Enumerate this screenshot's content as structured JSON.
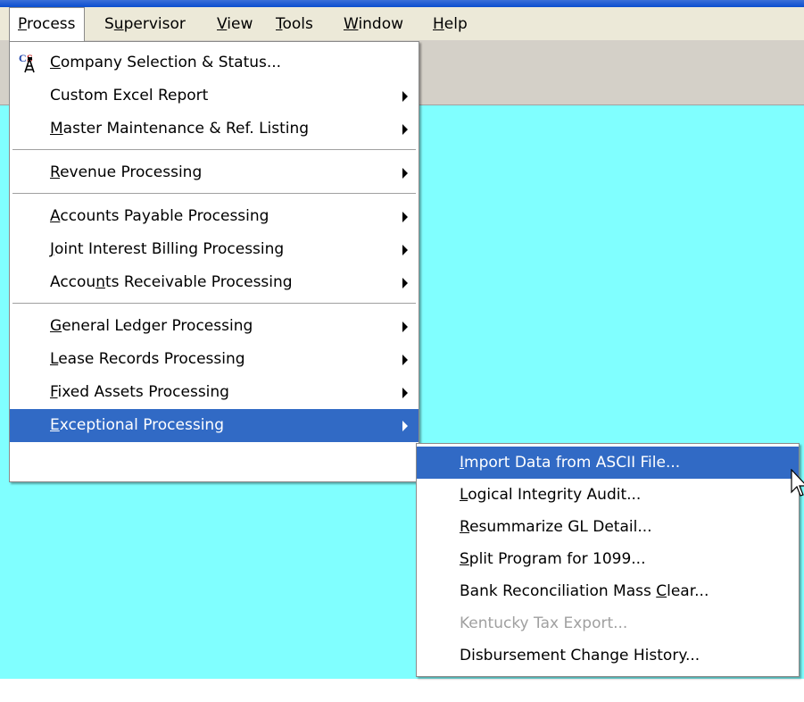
{
  "menubar": {
    "items": [
      {
        "pre": "",
        "u": "P",
        "post": "rocess"
      },
      {
        "pre": "S",
        "u": "u",
        "post": "pervisor"
      },
      {
        "pre": "",
        "u": "V",
        "post": "iew"
      },
      {
        "pre": "",
        "u": "T",
        "post": "ools"
      },
      {
        "pre": "",
        "u": "W",
        "post": "indow"
      },
      {
        "pre": "",
        "u": "H",
        "post": "elp"
      }
    ]
  },
  "process_menu": {
    "items": [
      {
        "pre": "",
        "u": "C",
        "post": "ompany Selection & Status..."
      },
      {
        "pre": "Custom Excel Report",
        "u": "",
        "post": ""
      },
      {
        "pre": "",
        "u": "M",
        "post": "aster Maintenance & Ref. Listing"
      },
      {
        "pre": "",
        "u": "R",
        "post": "evenue Processing"
      },
      {
        "pre": "",
        "u": "A",
        "post": "ccounts Payable Processing"
      },
      {
        "pre": "",
        "u": "J",
        "post": "oint Interest Billing Processing"
      },
      {
        "pre": "Accou",
        "u": "n",
        "post": "ts Receivable Processing"
      },
      {
        "pre": "",
        "u": "G",
        "post": "eneral Ledger Processing"
      },
      {
        "pre": "",
        "u": "L",
        "post": "ease Records Processing"
      },
      {
        "pre": "",
        "u": "F",
        "post": "ixed Assets Processing"
      },
      {
        "pre": "",
        "u": "E",
        "post": "xceptional Processing"
      }
    ]
  },
  "exceptional_submenu": {
    "items": [
      {
        "pre": "",
        "u": "I",
        "post": "mport Data from ASCII File..."
      },
      {
        "pre": "",
        "u": "L",
        "post": "ogical Integrity Audit..."
      },
      {
        "pre": "",
        "u": "R",
        "post": "esummarize GL Detail..."
      },
      {
        "pre": "",
        "u": "S",
        "post": "plit Program for 1099..."
      },
      {
        "pre": "Bank Reconciliation Mass ",
        "u": "C",
        "post": "lear..."
      },
      {
        "pre": "Kentucky Tax Export...",
        "u": "",
        "post": ""
      },
      {
        "pre": "Disbursement Change History...",
        "u": "",
        "post": ""
      }
    ]
  },
  "colors": {
    "workspace": "#80ffff",
    "highlight": "#316ac5",
    "menubar": "#ece9d8",
    "disabled": "#a0a0a0"
  }
}
